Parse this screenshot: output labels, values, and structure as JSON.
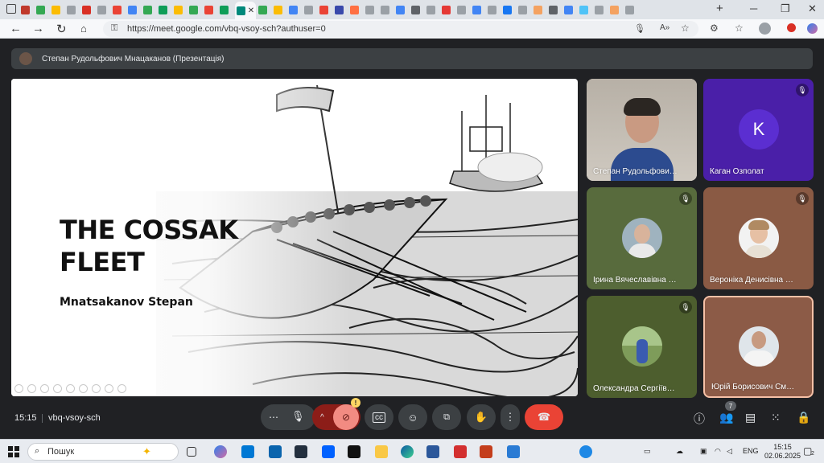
{
  "browser": {
    "url": "https://meet.google.com/vbq-vsoy-sch?authuser=0"
  },
  "meet": {
    "presenter_label": "Степан Рудольфович Мнацаканов (Презентація)",
    "slide": {
      "title": "THE COSSAK FLEET",
      "subtitle": "Mnatsakanov Stepan"
    },
    "participants": [
      {
        "name": "Степан Рудольфови…",
        "muted": false
      },
      {
        "name": "Каган Озполат",
        "initial": "K",
        "muted": true
      },
      {
        "name": "Ірина Вячеславівна …",
        "muted": true
      },
      {
        "name": "Вероніка Денисівна …",
        "muted": true
      },
      {
        "name": "Олександра Сергіїв…",
        "muted": true
      },
      {
        "name": "Юрій Борисович См…",
        "muted": false
      }
    ],
    "time": "15:15",
    "meeting_code": "vbq-vsoy-sch",
    "participants_count": "7",
    "camera_warning": "!"
  },
  "taskbar": {
    "search_placeholder": "Пошук",
    "language": "ENG",
    "clock_time": "15:15",
    "clock_date": "02.06.2025",
    "notification_count": "2"
  },
  "colors": {
    "meet_bg": "#202124",
    "end_call": "#ea4335",
    "mic_active": "#8c1d18",
    "tile_purple": "#5b2ed1"
  }
}
